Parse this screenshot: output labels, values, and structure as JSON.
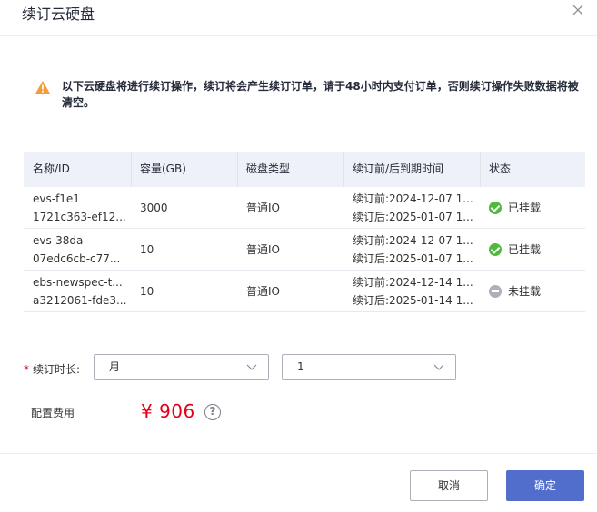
{
  "dialog": {
    "title": "续订云硬盘"
  },
  "notice": {
    "text": "以下云硬盘将进行续订操作，续订将会产生续订订单，请于48小时内支付订单，否则续订操作失败数据将被清空。"
  },
  "table": {
    "headers": [
      "名称/ID",
      "容量(GB)",
      "磁盘类型",
      "续订前/后到期时间",
      "状态"
    ],
    "rows": [
      {
        "name": "evs-f1e1",
        "id": "1721c363-ef12...",
        "capacity": "3000",
        "type": "普通IO",
        "before": "续订前:2024-12-07 1...",
        "after": "续订后:2025-01-07 1...",
        "status": "已挂载",
        "status_kind": "ok"
      },
      {
        "name": "evs-38da",
        "id": "07edc6cb-c77...",
        "capacity": "10",
        "type": "普通IO",
        "before": "续订前:2024-12-07 1...",
        "after": "续订后:2025-01-07 1...",
        "status": "已挂载",
        "status_kind": "ok"
      },
      {
        "name": "ebs-newspec-t...",
        "id": "a3212061-fde3...",
        "capacity": "10",
        "type": "普通IO",
        "before": "续订前:2024-12-14 1...",
        "after": "续订后:2025-01-14 1...",
        "status": "未挂载",
        "status_kind": "idle"
      }
    ]
  },
  "form": {
    "required_mark": "*",
    "duration_label": "续订时长:",
    "unit_value": "月",
    "count_value": "1",
    "fee_label": "配置费用",
    "fee_value": "¥ 906",
    "help_glyph": "?"
  },
  "footer": {
    "cancel_label": "取消",
    "confirm_label": "确定"
  },
  "colors": {
    "primary": "#526ecc",
    "success": "#50b83c",
    "warning": "#f39c3c",
    "price": "#e6001a"
  }
}
